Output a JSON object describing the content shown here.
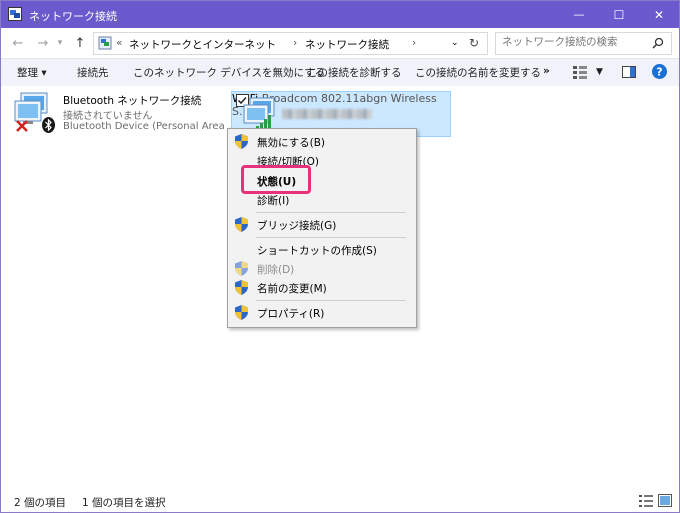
{
  "window": {
    "title": "ネットワーク接続",
    "accent_color": "#6a5acd"
  },
  "titlebar_controls": {
    "minimize": "—",
    "maximize": "☐",
    "close": "✕"
  },
  "address_bar": {
    "overflow": "«",
    "segments": [
      "ネットワークとインターネット",
      "ネットワーク接続"
    ],
    "separator": "›"
  },
  "search": {
    "placeholder": "ネットワーク接続の検索"
  },
  "toolbar": {
    "organize": "整理 ▾",
    "connect_to": "接続先",
    "disable_device": "このネットワーク デバイスを無効にする",
    "diagnose": "この接続を診断する",
    "rename": "この接続の名前を変更する",
    "more": "»"
  },
  "connections": [
    {
      "name": "Bluetooth ネットワーク接続",
      "status": "接続されていません",
      "device": "Bluetooth Device (Personal Area ..."
    },
    {
      "name": "Wi-Fi",
      "device": "Broadcom 802.11abgn Wireless S..."
    }
  ],
  "context_menu": {
    "items": [
      {
        "label": "無効にする(B)",
        "shield": true,
        "disabled": false
      },
      {
        "label": "接続/切断(O)",
        "shield": false,
        "disabled": false
      },
      {
        "label": "状態(U)",
        "shield": false,
        "disabled": false,
        "bold": true
      },
      {
        "label": "診断(I)",
        "shield": false,
        "disabled": false
      },
      {
        "label": "ブリッジ接続(G)",
        "shield": true,
        "disabled": false
      },
      {
        "label": "ショートカットの作成(S)",
        "shield": false,
        "disabled": false
      },
      {
        "label": "削除(D)",
        "shield": true,
        "disabled": true
      },
      {
        "label": "名前の変更(M)",
        "shield": true,
        "disabled": false
      },
      {
        "label": "プロパティ(R)",
        "shield": true,
        "disabled": false
      }
    ],
    "highlight_color": "#e8317a"
  },
  "status_bar": {
    "item_count": "2 個の項目",
    "selected": "1 個の項目を選択"
  }
}
